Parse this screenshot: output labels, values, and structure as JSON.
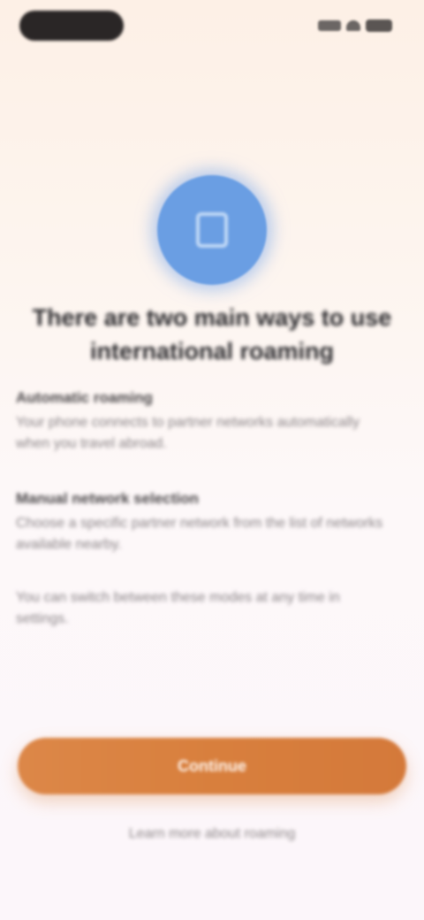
{
  "status_bar": {
    "icons": [
      "signal-icon",
      "wifi-icon",
      "battery-icon"
    ]
  },
  "hero": {
    "icon": "shield-icon",
    "color": "#6a9ee3"
  },
  "headline": "There are two main ways to use international roaming",
  "sections": [
    {
      "title": "Automatic roaming",
      "body": "Your phone connects to partner networks automatically when you travel abroad."
    },
    {
      "title": "Manual network selection",
      "body": "Choose a specific partner network from the list of networks available nearby."
    },
    {
      "title": "",
      "body": "You can switch between these modes at any time in settings."
    }
  ],
  "actions": {
    "primary_label": "Continue",
    "secondary_label": "Learn more about roaming",
    "accent_color": "#d87f3d"
  }
}
